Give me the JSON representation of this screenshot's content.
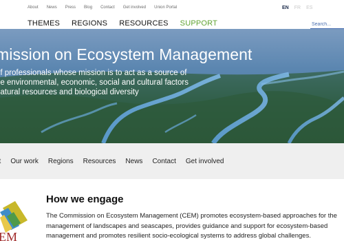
{
  "utility": {
    "links": [
      "About",
      "News",
      "Press",
      "Blog",
      "Contact",
      "Get involved",
      "Union Portal"
    ],
    "languages": [
      {
        "code": "EN",
        "active": true
      },
      {
        "code": "FR",
        "active": false
      },
      {
        "code": "ES",
        "active": false
      }
    ]
  },
  "mainnav": {
    "items": [
      "THEMES",
      "REGIONS",
      "RESOURCES",
      "SUPPORT"
    ],
    "support_color": "#5fa331"
  },
  "search": {
    "placeholder": "Search..."
  },
  "hero": {
    "title": "mission on Ecosystem Management",
    "subtitle_lines": [
      "of professionals whose mission is to act as a source of",
      "he environmental, economic, social and cultural factors",
      "natural resources and biological diversity"
    ]
  },
  "subnav": {
    "items": [
      "ut",
      "Our work",
      "Regions",
      "Resources",
      "News",
      "Contact",
      "Get involved"
    ]
  },
  "content": {
    "heading": "How we engage",
    "body": "The Commission on Ecosystem Management (CEM) promotes ecosystem-based approaches for the management of landscapes and seascapes, provides guidance and support for ecosystem-based management and promotes resilient socio-ecological systems to address global challenges.",
    "logo_text": "EM"
  }
}
